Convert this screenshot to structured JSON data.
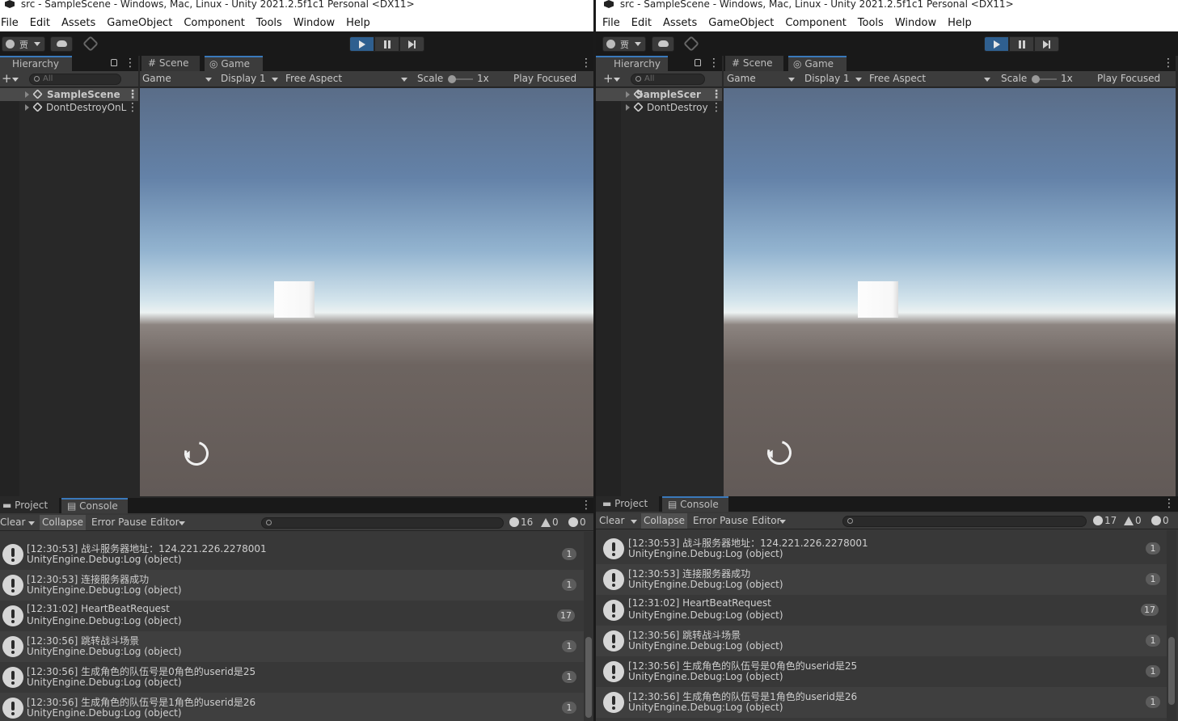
{
  "windows": [
    {
      "title": "src - SampleScene - Windows, Mac, Linux - Unity 2021.2.5f1c1 Personal <DX11>",
      "menu": [
        "File",
        "Edit",
        "Assets",
        "GameObject",
        "Component",
        "Tools",
        "Window",
        "Help"
      ],
      "account_label": "贾",
      "hierarchy": {
        "tab": "Hierarchy",
        "search_placeholder": "All",
        "items": [
          "SampleScene",
          "DontDestroyOnL"
        ]
      },
      "view_tabs": [
        "Scene",
        "Game"
      ],
      "game_toolbar": {
        "mode": "Game",
        "display": "Display 1",
        "aspect": "Free Aspect",
        "scale_label": "Scale",
        "scale_value": "1x",
        "play_mode": "Play Focused"
      },
      "bottom_tabs": [
        "Project",
        "Console"
      ],
      "console_toolbar": {
        "clear": "Clear",
        "collapse": "Collapse",
        "error_pause": "Error Pause",
        "editor": "Editor",
        "log_count": "16",
        "warn_count": "0",
        "error_count": "0"
      },
      "console_rows": [
        {
          "msg": "[12:30:53] 战斗服务器地址：124.221.226.2278001",
          "src": "UnityEngine.Debug:Log (object)",
          "count": "1"
        },
        {
          "msg": "[12:30:53] 连接服务器成功",
          "src": "UnityEngine.Debug:Log (object)",
          "count": "1"
        },
        {
          "msg": "[12:31:02] HeartBeatRequest",
          "src": "UnityEngine.Debug:Log (object)",
          "count": "17"
        },
        {
          "msg": "[12:30:56] 跳转战斗场景",
          "src": "UnityEngine.Debug:Log (object)",
          "count": "1"
        },
        {
          "msg": "[12:30:56] 生成角色的队伍号是0角色的userid是25",
          "src": "UnityEngine.Debug:Log (object)",
          "count": "1"
        },
        {
          "msg": "[12:30:56] 生成角色的队伍号是1角色的userid是26",
          "src": "UnityEngine.Debug:Log (object)",
          "count": "1"
        }
      ]
    },
    {
      "title": "src - SampleScene - Windows, Mac, Linux - Unity 2021.2.5f1c1 Personal <DX11>",
      "menu": [
        "File",
        "Edit",
        "Assets",
        "GameObject",
        "Component",
        "Tools",
        "Window",
        "Help"
      ],
      "account_label": "贾",
      "hierarchy": {
        "tab": "Hierarchy",
        "search_placeholder": "All",
        "items": [
          "SampleScer",
          "DontDestroy"
        ]
      },
      "view_tabs": [
        "Scene",
        "Game"
      ],
      "game_toolbar": {
        "mode": "Game",
        "display": "Display 1",
        "aspect": "Free Aspect",
        "scale_label": "Scale",
        "scale_value": "1x",
        "play_mode": "Play Focused"
      },
      "bottom_tabs": [
        "Project",
        "Console"
      ],
      "console_toolbar": {
        "clear": "Clear",
        "collapse": "Collapse",
        "error_pause": "Error Pause",
        "editor": "Editor",
        "log_count": "17",
        "warn_count": "0",
        "error_count": "0"
      },
      "console_rows": [
        {
          "msg": "[12:30:53] 战斗服务器地址：124.221.226.2278001",
          "src": "UnityEngine.Debug:Log (object)",
          "count": "1"
        },
        {
          "msg": "[12:30:53] 连接服务器成功",
          "src": "UnityEngine.Debug:Log (object)",
          "count": "1"
        },
        {
          "msg": "[12:31:02] HeartBeatRequest",
          "src": "UnityEngine.Debug:Log (object)",
          "count": "17"
        },
        {
          "msg": "[12:30:56] 跳转战斗场景",
          "src": "UnityEngine.Debug:Log (object)",
          "count": "1"
        },
        {
          "msg": "[12:30:56] 生成角色的队伍号是0角色的userid是25",
          "src": "UnityEngine.Debug:Log (object)",
          "count": "1"
        },
        {
          "msg": "[12:30:56] 生成角色的队伍号是1角色的userid是26",
          "src": "UnityEngine.Debug:Log (object)",
          "count": "1"
        }
      ]
    }
  ],
  "colors": {
    "play_active": "#2f5f8f",
    "tab_accent": "#3a79bb",
    "panel_bg": "#282828",
    "toolbar_bg": "#3c3c3c"
  }
}
